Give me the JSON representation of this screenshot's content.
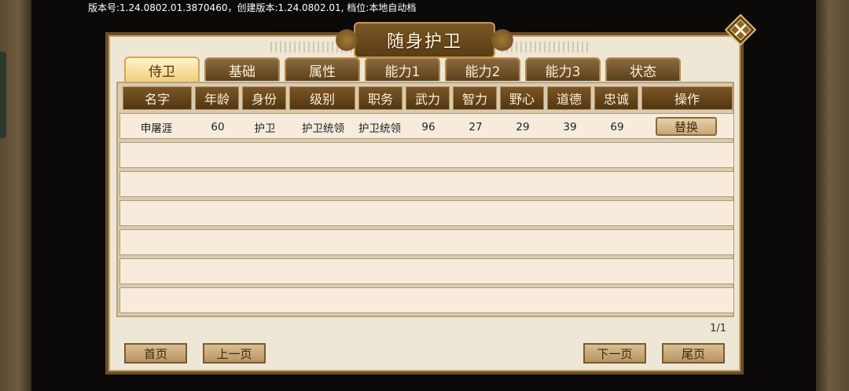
{
  "version_text": "版本号:1.24.0802.01.3870460，创建版本:1.24.0802.01, 档位:本地自动档",
  "window": {
    "title": "随身护卫"
  },
  "close_icon": "close-diamond-icon",
  "tabs": [
    {
      "label": "侍卫",
      "active": true
    },
    {
      "label": "基础",
      "active": false
    },
    {
      "label": "属性",
      "active": false
    },
    {
      "label": "能力1",
      "active": false
    },
    {
      "label": "能力2",
      "active": false
    },
    {
      "label": "能力3",
      "active": false
    },
    {
      "label": "状态",
      "active": false
    }
  ],
  "table": {
    "headers": [
      "名字",
      "年龄",
      "身份",
      "级别",
      "职务",
      "武力",
      "智力",
      "野心",
      "道德",
      "忠诚",
      "操作"
    ],
    "rows": [
      {
        "cells": [
          "申屠涯",
          "60",
          "护卫",
          "护卫统领",
          "护卫统领",
          "96",
          "27",
          "29",
          "39",
          "69"
        ],
        "action": "替换"
      }
    ],
    "empty_rows": 6
  },
  "pagination": {
    "indicator": "1/1",
    "first": "首页",
    "prev": "上一页",
    "next": "下一页",
    "last": "尾页"
  },
  "colors": {
    "frame": "#6b4e2a",
    "panel_bg": "#efe7d6",
    "header_bg": "#5b3f1c",
    "active_tab": "#f1cd7a"
  }
}
